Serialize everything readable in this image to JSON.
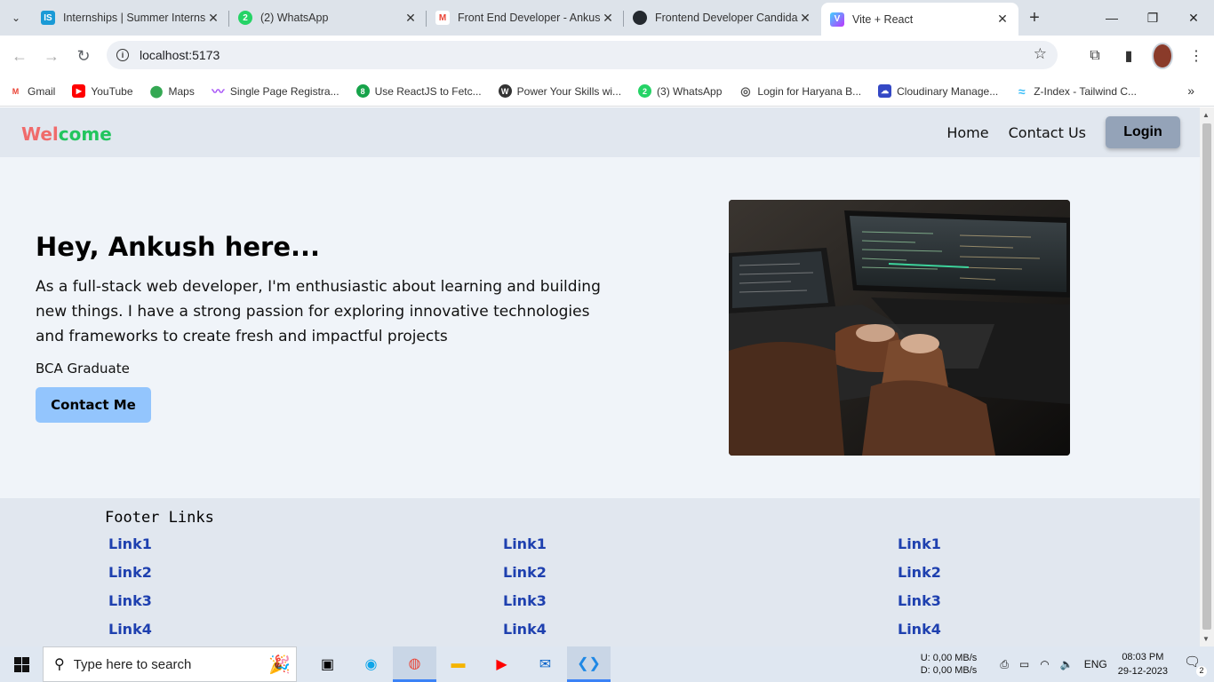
{
  "browser": {
    "tabs": [
      {
        "title": "Internships | Summer Interns",
        "icon": "internshala-icon",
        "color": "#1a9ad6",
        "glyph": "IS"
      },
      {
        "title": "(2) WhatsApp",
        "icon": "whatsapp-icon",
        "color": "#25d366",
        "glyph": "2"
      },
      {
        "title": "Front End Developer - Ankus",
        "icon": "gmail-icon",
        "color": "#ea4335",
        "glyph": "M"
      },
      {
        "title": "Frontend Developer Candida",
        "icon": "github-icon",
        "color": "#24292f",
        "glyph": "●"
      },
      {
        "title": "Vite + React",
        "icon": "vite-icon",
        "color": "#8b5cf6",
        "glyph": "V"
      }
    ],
    "url": "localhost:5173",
    "bookmarks": [
      {
        "label": "Gmail",
        "icon": "gmail-icon",
        "color": "#ea4335",
        "glyph": "M"
      },
      {
        "label": "YouTube",
        "icon": "youtube-icon",
        "color": "#ff0000",
        "glyph": "▶"
      },
      {
        "label": "Maps",
        "icon": "maps-icon",
        "color": "#34a853",
        "glyph": "●"
      },
      {
        "label": "Single Page Registra...",
        "icon": "swirl-icon",
        "color": "#a855f7",
        "glyph": "~"
      },
      {
        "label": "Use ReactJS to Fetc...",
        "icon": "green-circle-icon",
        "color": "#16a34a",
        "glyph": "8"
      },
      {
        "label": "Power Your Skills wi...",
        "icon": "wordpress-icon",
        "color": "#333333",
        "glyph": "W"
      },
      {
        "label": "(3) WhatsApp",
        "icon": "whatsapp-icon",
        "color": "#25d366",
        "glyph": "2"
      },
      {
        "label": "Login for Haryana B...",
        "icon": "globe-icon",
        "color": "#555555",
        "glyph": "◎"
      },
      {
        "label": "Cloudinary Manage...",
        "icon": "cloudinary-icon",
        "color": "#3448c5",
        "glyph": "☁"
      },
      {
        "label": "Z-Index - Tailwind C...",
        "icon": "tailwind-icon",
        "color": "#38bdf8",
        "glyph": "≈"
      }
    ]
  },
  "site": {
    "logo_part1": "Wel",
    "logo_part2": "come",
    "nav": {
      "home": "Home",
      "contact": "Contact Us",
      "login": "Login"
    },
    "hero": {
      "heading": "Hey, Ankush here...",
      "intro": "As a full-stack web developer, I'm enthusiastic about learning and building new things. I have a strong passion for exploring innovative technologies and frameworks to create fresh and impactful projects",
      "degree": "BCA Graduate",
      "cta": "Contact Me"
    },
    "footer": {
      "title": "Footer Links",
      "columns": [
        [
          "Link1",
          "Link2",
          "Link3",
          "Link4"
        ],
        [
          "Link1",
          "Link2",
          "Link3",
          "Link4"
        ],
        [
          "Link1",
          "Link2",
          "Link3",
          "Link4"
        ]
      ]
    }
  },
  "taskbar": {
    "search_placeholder": "Type here to search",
    "net_up": "U:      0,00 MB/s",
    "net_down": "D:      0,00 MB/s",
    "lang": "ENG",
    "time": "08:03 PM",
    "date": "29-12-2023",
    "notifications": "2"
  },
  "colors": {
    "logo_red": "#f06b6b",
    "logo_green": "#22c55e",
    "link_blue": "#1e40af",
    "cta_blue": "#93c5fd",
    "login_gray": "#94a3b8"
  }
}
